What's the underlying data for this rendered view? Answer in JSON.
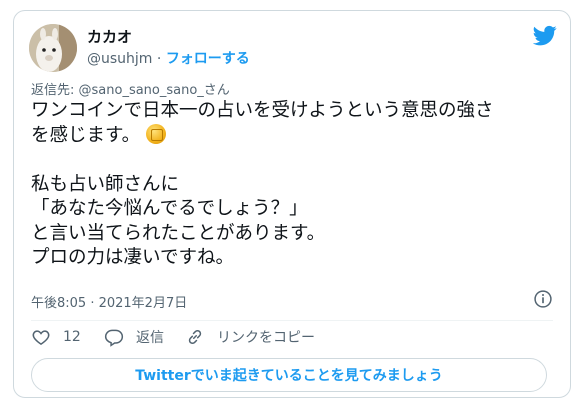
{
  "author": {
    "display_name": "カカオ",
    "handle": "@usuhjm",
    "separator": " · ",
    "follow_label": "フォローする"
  },
  "reply": {
    "prefix": "返信先: ",
    "handle": "@sano_sano_sano_さん"
  },
  "tweet": {
    "line1": "ワンコインで日本一の占いを受けようという意思の強さ",
    "line2": "を感じます。",
    "line2_emoji": "coin-emoji",
    "line3": "私も占い師さんに",
    "line4": "「あなた今悩んでるでしょう？」",
    "line5": "と言い当てられたことがあります。",
    "line6": "プロの力は凄いですね。"
  },
  "timestamp": "午後8:05 · 2021年2月7日",
  "actions": {
    "like_count": "12",
    "reply_label": "返信",
    "copy_label": "リンクをコピー"
  },
  "cta_label": "Twitterでいま起きていることを見てみましょう",
  "colors": {
    "accent": "#1d9bf0",
    "secondary_text": "#536471",
    "border": "#cfd9de"
  }
}
